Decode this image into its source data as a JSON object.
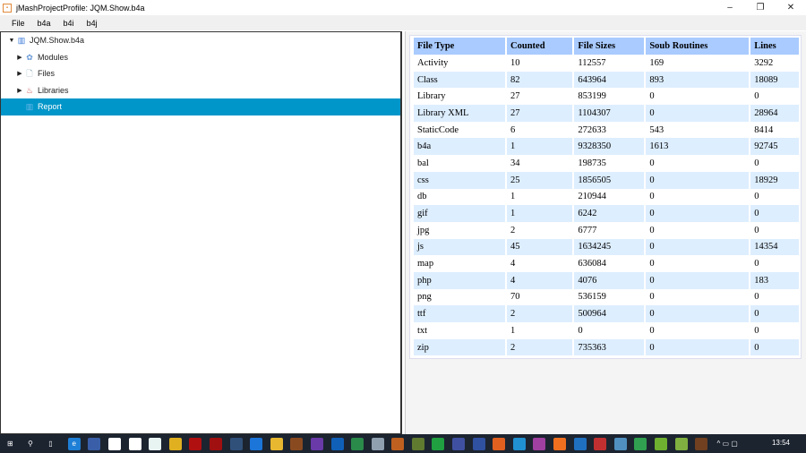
{
  "window": {
    "title": "jMashProjectProfile: JQM.Show.b4a",
    "minimize": "–",
    "maximize": "❐",
    "close": "✕"
  },
  "menu": [
    "File",
    "b4a",
    "b4i",
    "b4j"
  ],
  "tree": {
    "root": "JQM.Show.b4a",
    "items": [
      {
        "label": "Modules",
        "icon": "modules-icon"
      },
      {
        "label": "Files",
        "icon": "file-icon"
      },
      {
        "label": "Libraries",
        "icon": "library-icon"
      },
      {
        "label": "Report",
        "icon": "report-icon",
        "selected": true
      }
    ]
  },
  "table": {
    "headers": [
      "File Type",
      "Counted",
      "File Sizes",
      "Soub Routines",
      "Lines"
    ],
    "rows": [
      [
        "Activity",
        "10",
        "112557",
        "169",
        "3292"
      ],
      [
        "Class",
        "82",
        "643964",
        "893",
        "18089"
      ],
      [
        "Library",
        "27",
        "853199",
        "0",
        "0"
      ],
      [
        "Library XML",
        "27",
        "1104307",
        "0",
        "28964"
      ],
      [
        "StaticCode",
        "6",
        "272633",
        "543",
        "8414"
      ],
      [
        "b4a",
        "1",
        "9328350",
        "1613",
        "92745"
      ],
      [
        "bal",
        "34",
        "198735",
        "0",
        "0"
      ],
      [
        "css",
        "25",
        "1856505",
        "0",
        "18929"
      ],
      [
        "db",
        "1",
        "210944",
        "0",
        "0"
      ],
      [
        "gif",
        "1",
        "6242",
        "0",
        "0"
      ],
      [
        "jpg",
        "2",
        "6777",
        "0",
        "0"
      ],
      [
        "js",
        "45",
        "1634245",
        "0",
        "14354"
      ],
      [
        "map",
        "4",
        "636084",
        "0",
        "0"
      ],
      [
        "php",
        "4",
        "4076",
        "0",
        "183"
      ],
      [
        "png",
        "70",
        "536159",
        "0",
        "0"
      ],
      [
        "ttf",
        "2",
        "500964",
        "0",
        "0"
      ],
      [
        "txt",
        "1",
        "0",
        "0",
        "0"
      ],
      [
        "zip",
        "2",
        "735363",
        "0",
        "0"
      ]
    ]
  },
  "colors": {
    "selection": "#0096c9",
    "header": "#a9cbff",
    "alt_row": "#ddeeff",
    "taskbar": "#1c2430"
  },
  "taskbar": {
    "clock": "13:54",
    "icons": [
      {
        "name": "start",
        "color": "#ffffff",
        "glyph": "⊞"
      },
      {
        "name": "search",
        "color": "transparent",
        "glyph": "⚲"
      },
      {
        "name": "task-view",
        "color": "transparent",
        "glyph": "▯"
      },
      {
        "name": "edge",
        "color": "#1e7fd6",
        "glyph": "e"
      },
      {
        "name": "app1",
        "color": "#3a5fa8",
        "glyph": ""
      },
      {
        "name": "app2",
        "color": "#ffffff",
        "glyph": ""
      },
      {
        "name": "app3",
        "color": "#ffffff",
        "glyph": ""
      },
      {
        "name": "app4",
        "color": "#e8f4f2",
        "glyph": ""
      },
      {
        "name": "chrome",
        "color": "#e0b020",
        "glyph": ""
      },
      {
        "name": "filezilla",
        "color": "#b01010",
        "glyph": ""
      },
      {
        "name": "app5",
        "color": "#a01010",
        "glyph": ""
      },
      {
        "name": "app6",
        "color": "#30507a",
        "glyph": ""
      },
      {
        "name": "dropbox",
        "color": "#1c75d8",
        "glyph": ""
      },
      {
        "name": "explorer",
        "color": "#e8b830",
        "glyph": ""
      },
      {
        "name": "app7",
        "color": "#8a4a20",
        "glyph": ""
      },
      {
        "name": "visual-studio",
        "color": "#6a3aa8",
        "glyph": ""
      },
      {
        "name": "outlook",
        "color": "#1060b8",
        "glyph": ""
      },
      {
        "name": "app8",
        "color": "#2a8a4a",
        "glyph": ""
      },
      {
        "name": "app9",
        "color": "#90a0b0",
        "glyph": ""
      },
      {
        "name": "app10",
        "color": "#c06020",
        "glyph": ""
      },
      {
        "name": "app11",
        "color": "#607a30",
        "glyph": ""
      },
      {
        "name": "app12",
        "color": "#20a040",
        "glyph": ""
      },
      {
        "name": "app13",
        "color": "#4050a0",
        "glyph": ""
      },
      {
        "name": "app14",
        "color": "#3050a0",
        "glyph": ""
      },
      {
        "name": "firefox",
        "color": "#e06020",
        "glyph": ""
      },
      {
        "name": "app15",
        "color": "#2090d0",
        "glyph": ""
      },
      {
        "name": "app16",
        "color": "#a040a0",
        "glyph": ""
      },
      {
        "name": "xampp",
        "color": "#f07020",
        "glyph": ""
      },
      {
        "name": "app17",
        "color": "#2070c0",
        "glyph": ""
      },
      {
        "name": "app18",
        "color": "#c03030",
        "glyph": ""
      },
      {
        "name": "app19",
        "color": "#5090c0",
        "glyph": ""
      },
      {
        "name": "app20",
        "color": "#30a050",
        "glyph": ""
      },
      {
        "name": "android",
        "color": "#70b030",
        "glyph": ""
      },
      {
        "name": "app21",
        "color": "#80b040",
        "glyph": ""
      },
      {
        "name": "app22",
        "color": "#704020",
        "glyph": ""
      }
    ]
  }
}
